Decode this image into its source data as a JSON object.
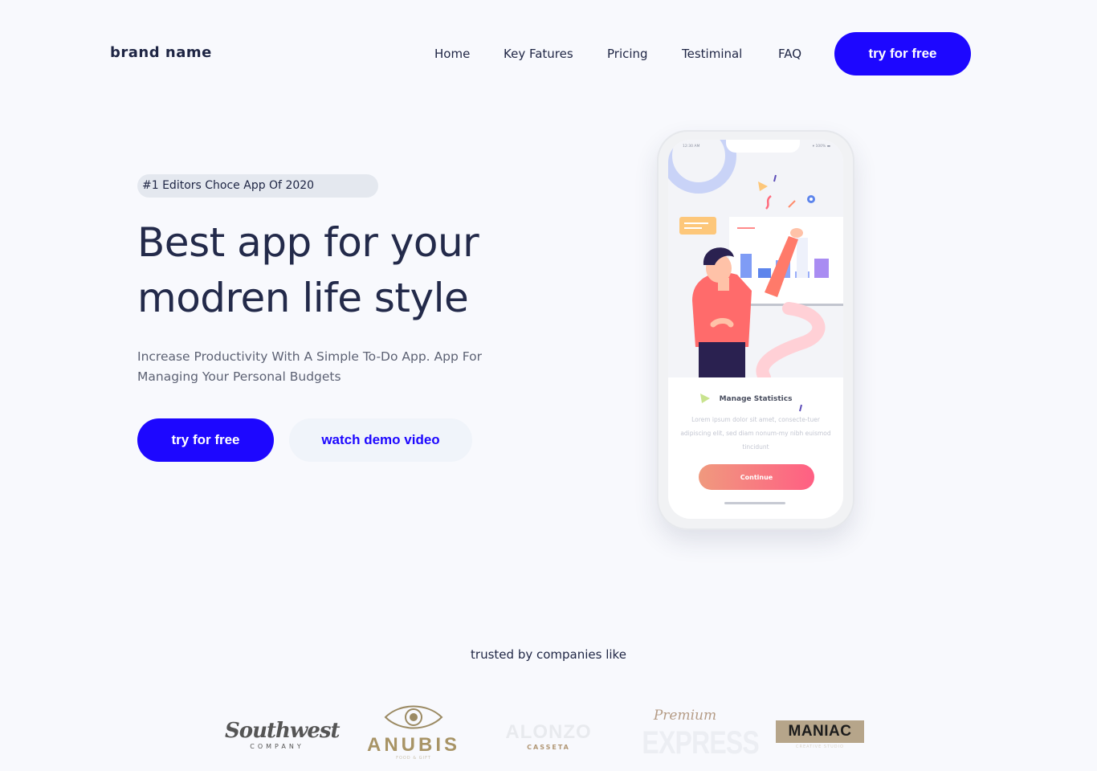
{
  "header": {
    "brand": "brand name",
    "nav": [
      "Home",
      "Key Fatures",
      "Pricing",
      "Testiminal",
      "FAQ"
    ],
    "cta_label": "try for free"
  },
  "hero": {
    "badge": "#1 Editors Choce App Of 2020",
    "title_line1": "Best app for your",
    "title_line2": "modren life style",
    "subtitle": "Increase Productivity With A Simple To-Do App. App For Managing Your Personal Budgets",
    "primary_cta": "try for free",
    "secondary_cta": "watch demo video"
  },
  "phone": {
    "status_time": "12:30 AM",
    "status_right": "▾ 100% ▬",
    "card_title": "Manage Statistics",
    "card_text": "Lorem ipsum dolor sit amet, consecte-tuer adipiscing elit, sed diam nonum-my nibh euismod tincidunt",
    "button": "Continue"
  },
  "trusted": {
    "heading": "trusted by companies like",
    "logos": [
      {
        "name": "Southwest",
        "sub": "COMPANY"
      },
      {
        "name": "ANUBIS",
        "sub": "FOOD & GIFT"
      },
      {
        "name": "ALONZO",
        "sub": "CASSETA"
      },
      {
        "name": "EXPRESS",
        "script": "Premium"
      },
      {
        "name": "MANIAC",
        "sub": "CREATIVE STUDIO"
      }
    ]
  },
  "colors": {
    "primary": "#1d07ff",
    "text_dark": "#1e2544",
    "background": "#f8f9fd",
    "badge_bg": "#e4e8ef",
    "secondary_btn_bg": "#f0f4fa"
  }
}
